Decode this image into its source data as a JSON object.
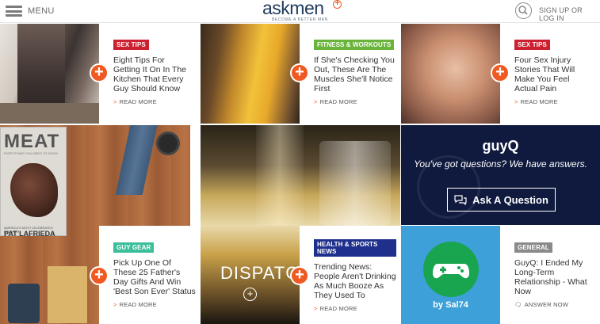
{
  "header": {
    "menu_label": "MENU",
    "logo_text": "askmen",
    "logo_tagline": "BECOME A BETTER MAN",
    "sign_label": "SIGN UP OR LOG IN"
  },
  "cards": [
    {
      "badge": "SEX TIPS",
      "title": "Eight Tips For Getting It On In The Kitchen That Every Guy Should Know",
      "more": "READ MORE"
    },
    {
      "badge": "FITNESS & WORKOUTS",
      "title": "If She's Checking You Out, These Are The Muscles She'll Notice First",
      "more": "READ MORE"
    },
    {
      "badge": "SEX TIPS",
      "title": "Four Sex Injury Stories That Will Make You Feel Actual Pain",
      "more": "READ MORE"
    },
    {
      "badge": "GUY GEAR",
      "title": "Pick Up One Of These 25 Father's Day Gifts And Win 'Best Son Ever' Status",
      "more": "READ MORE"
    },
    {
      "badge": "HEALTH & SPORTS NEWS",
      "title": "Trending News: People Aren't Drinking As Much Booze As They Used To",
      "more": "READ MORE"
    },
    {
      "badge": "GENERAL",
      "title": "GuyQ: I Ended My Long-Term Relationship - What Now",
      "more": "ANSWER NOW"
    }
  ],
  "meat_cover": {
    "title": "MEAT",
    "subtitle": "EVERYTHING YOU NEED TO KNOW",
    "author_line": "AMERICA'S MOST CELEBRATED BUTCHER",
    "author": "PAT LAFRIEDA"
  },
  "dispatch_label": "DISPATCH",
  "guyq": {
    "logo": "guyQ",
    "tagline": "You've got questions? We have answers.",
    "button": "Ask A Question"
  },
  "user": {
    "name": "by Sal74"
  },
  "colors": {
    "accent": "#f05a22",
    "sex_tips": "#cc1f2f",
    "fitness": "#6bb43b",
    "guy_gear": "#3bbf9a",
    "news": "#1f2f8c",
    "general": "#8a8a8a",
    "navy": "#0f1a3e",
    "blue": "#3ea0d8",
    "green": "#19a450"
  }
}
